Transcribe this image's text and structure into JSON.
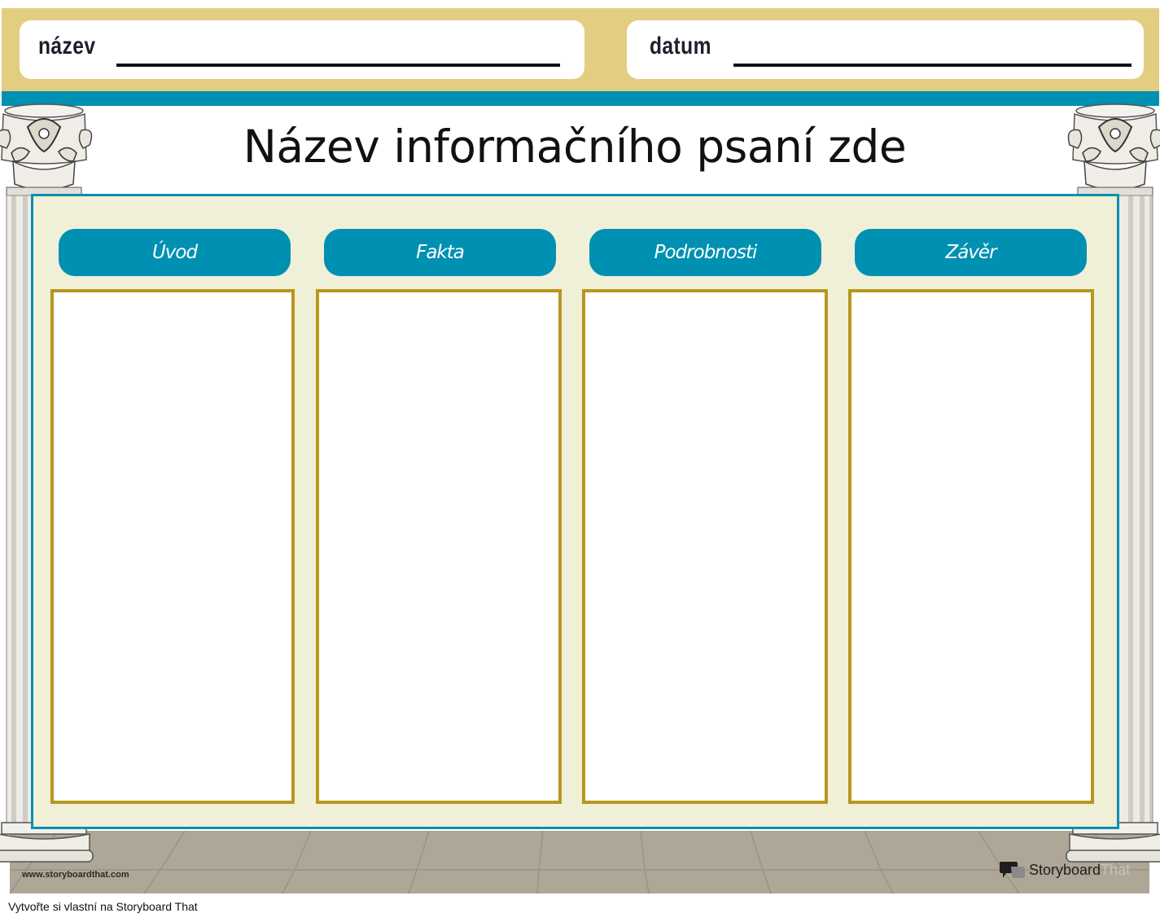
{
  "header": {
    "name_label": "název",
    "date_label": "datum"
  },
  "title": "Název informačního psaní zde",
  "columns": [
    {
      "label": "Úvod"
    },
    {
      "label": "Fakta"
    },
    {
      "label": "Podrobnosti"
    },
    {
      "label": "Závěr"
    }
  ],
  "footer": {
    "website": "www.storyboardthat.com",
    "logo_word1": "Storyboard",
    "logo_word2": "That",
    "create_note": "Vytvořte si vlastní na Storyboard That"
  },
  "colors": {
    "header_gold": "#e3cd80",
    "teal": "#0090b2",
    "board_cream": "#f0f0d8",
    "box_border_gold": "#b8971e",
    "floor_gray": "#aea797"
  }
}
